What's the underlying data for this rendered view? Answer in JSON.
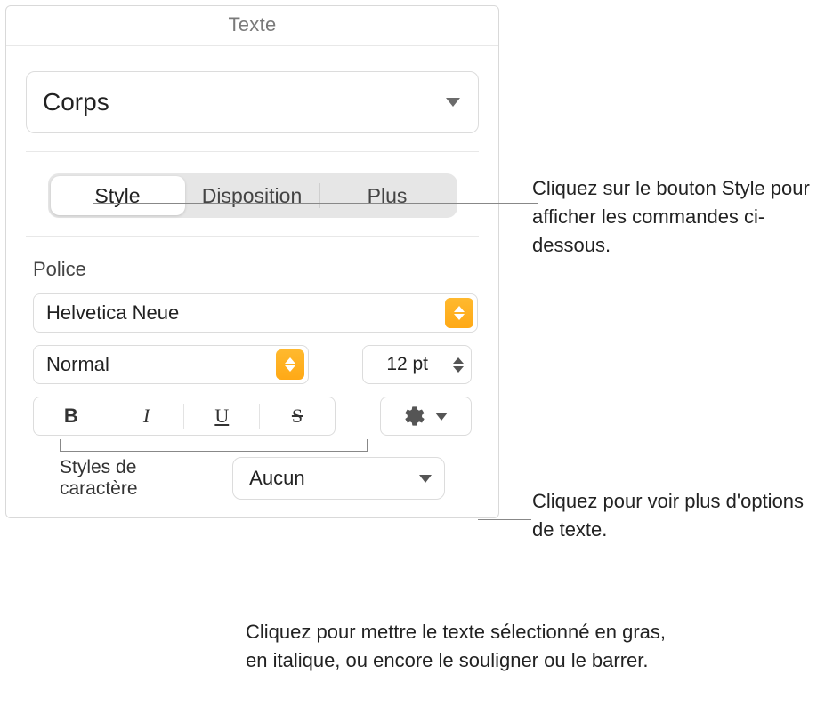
{
  "panel": {
    "title": "Texte",
    "paragraphStyle": "Corps",
    "tabs": {
      "style": "Style",
      "layout": "Disposition",
      "more": "Plus"
    },
    "font": {
      "sectionLabel": "Police",
      "family": "Helvetica Neue",
      "weight": "Normal",
      "size": "12 pt",
      "format": {
        "bold": "B",
        "italic": "I",
        "underline": "U",
        "strike": "S"
      },
      "charStylesLabel": "Styles de caractère",
      "charStyleValue": "Aucun"
    }
  },
  "callouts": {
    "styleTab": "Cliquez sur le bouton Style pour afficher les commandes ci-dessous.",
    "gear": "Cliquez pour voir plus d'options de texte.",
    "bius": "Cliquez pour mettre le texte sélectionné en gras, en italique, ou encore le souligner ou le barrer."
  }
}
